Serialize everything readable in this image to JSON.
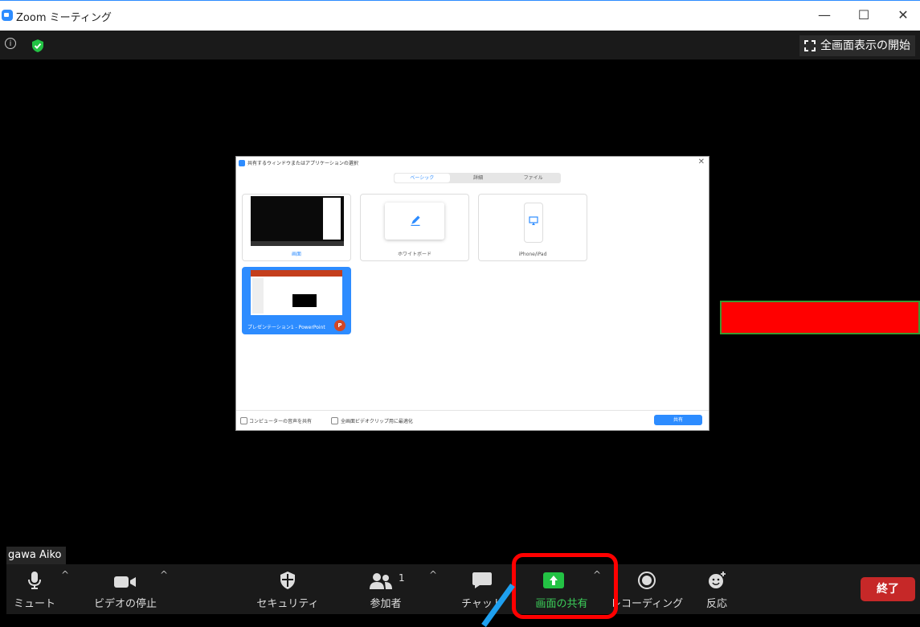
{
  "window": {
    "title": "Zoom ミーティング",
    "minimize": "—",
    "maximize": "☐",
    "close": "✕"
  },
  "topbar": {
    "fullscreen_label": "全画面表示の開始"
  },
  "participant": {
    "name": "gawa Aiko"
  },
  "share_dialog": {
    "title": "共有するウィンドウまたはアプリケーションの選択",
    "tabs": [
      "ベーシック",
      "詳細",
      "ファイル"
    ],
    "tiles": [
      {
        "label": "画面"
      },
      {
        "label": "ホワイトボード"
      },
      {
        "label": "iPhone/iPad"
      },
      {
        "label": "プレゼンテーション1 - PowerPoint"
      }
    ],
    "option_audio": "コンピューターの音声を共有",
    "option_video": "全画面ビデオクリップ用に最適化",
    "share_button": "共有"
  },
  "toolbar": {
    "mute": "ミュート",
    "video": "ビデオの停止",
    "security": "セキュリティ",
    "participants": "参加者",
    "participants_count": "1",
    "chat": "チャット",
    "share": "画面の共有",
    "record": "レコーディング",
    "reactions": "反応",
    "end": "終了"
  },
  "colors": {
    "accent": "#2d8cff",
    "share_green": "#23c244",
    "end_red": "#c62828",
    "highlight": "#ff0000"
  }
}
